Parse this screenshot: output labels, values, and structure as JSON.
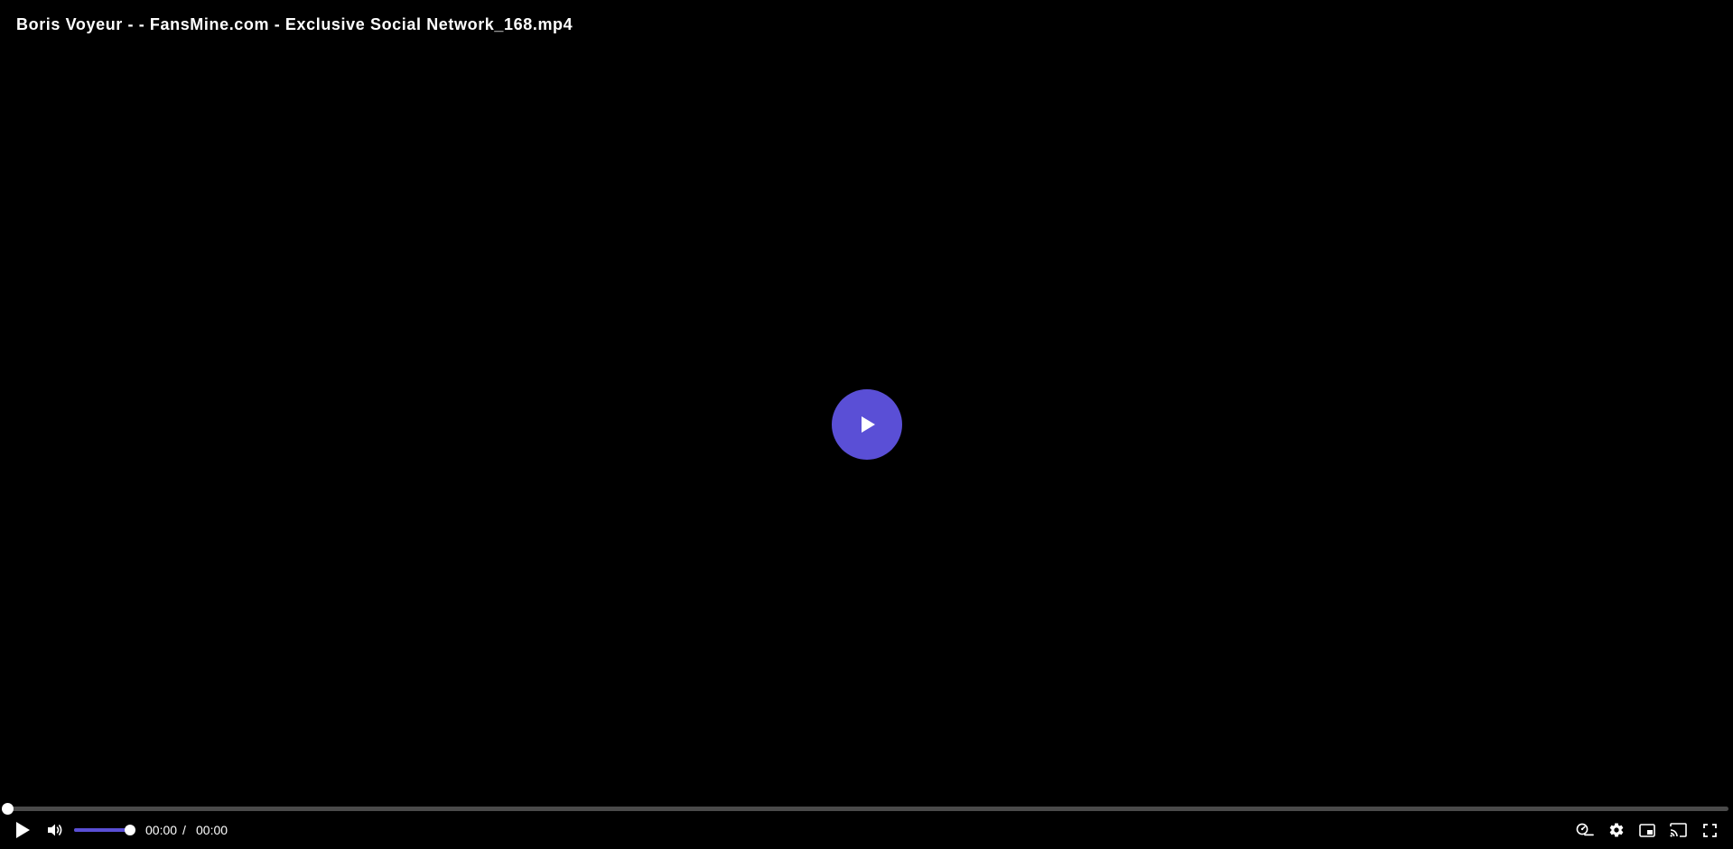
{
  "title": "Boris Voyeur - - FansMine.com - Exclusive Social Network_168.mp4",
  "colors": {
    "accent": "#5a4fd6",
    "background": "#000000",
    "track": "#4a4a4a",
    "icon": "#ffffff"
  },
  "playback": {
    "current_time": "00:00",
    "separator": "/",
    "duration": "00:00",
    "progress_fraction": 0
  },
  "volume": {
    "level_fraction": 1.0
  },
  "icons": {
    "big_play": "play-icon",
    "play": "play-icon",
    "volume": "volume-icon",
    "speed": "playback-speed-icon",
    "settings": "gear-icon",
    "pip": "picture-in-picture-icon",
    "cast": "cast-icon",
    "fullscreen": "fullscreen-icon"
  }
}
